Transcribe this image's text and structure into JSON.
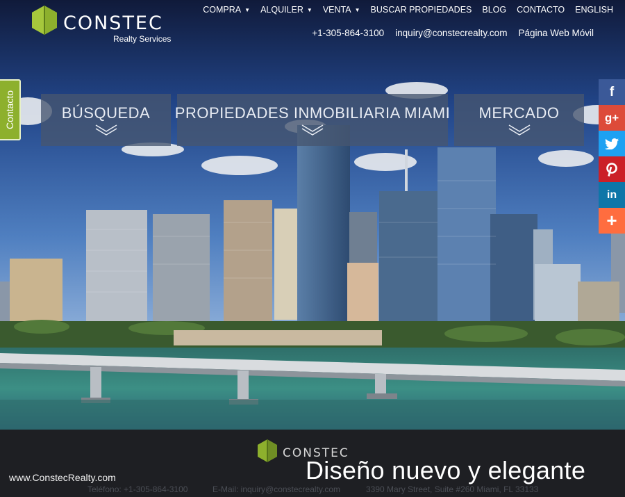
{
  "brand": {
    "name": "CONSTEC",
    "tagline": "Realty Services"
  },
  "colors": {
    "accent_green": "#8db02d",
    "panel": "#465670",
    "footer": "#1e1f23"
  },
  "nav": {
    "items": [
      {
        "label": "COMPRA",
        "dropdown": true
      },
      {
        "label": "ALQUILER",
        "dropdown": true
      },
      {
        "label": "VENTA",
        "dropdown": true
      },
      {
        "label": "BUSCAR PROPIEDADES",
        "dropdown": false
      },
      {
        "label": "BLOG",
        "dropdown": false
      },
      {
        "label": "CONTACTO",
        "dropdown": false
      },
      {
        "label": "ENGLISH",
        "dropdown": false
      }
    ],
    "phone": "+1-305-864-3100",
    "email": "inquiry@constecrealty.com",
    "mobile": "Página Web Móvil"
  },
  "side_tab": {
    "label": "Contacto"
  },
  "panels": [
    {
      "label": "BÚSQUEDA"
    },
    {
      "label": "PROPIEDADES INMOBILIARIA MIAMI"
    },
    {
      "label": "MERCADO"
    }
  ],
  "social": [
    {
      "icon": "facebook-icon",
      "glyph": "f",
      "color": "#3b5998"
    },
    {
      "icon": "google-plus-icon",
      "glyph": "g+",
      "color": "#dd4b39"
    },
    {
      "icon": "twitter-icon",
      "glyph": "t",
      "color": "#1da1f2"
    },
    {
      "icon": "pinterest-icon",
      "glyph": "P",
      "color": "#cb2027"
    },
    {
      "icon": "linkedin-icon",
      "glyph": "in",
      "color": "#0e76a8"
    },
    {
      "icon": "share-plus-icon",
      "glyph": "+",
      "color": "#ff6d3f"
    }
  ],
  "footer": {
    "brand": "CONSTEC",
    "phone_line": "Teléfono: +1-305-864-3100",
    "email_line": "E-Mail: inquiry@constecrealty.com",
    "address_line": "3390 Mary Street, Suite #260 Miami, FL 33133",
    "site": "www.ConstecRealty.com",
    "headline": "Diseño nuevo y elegante"
  }
}
